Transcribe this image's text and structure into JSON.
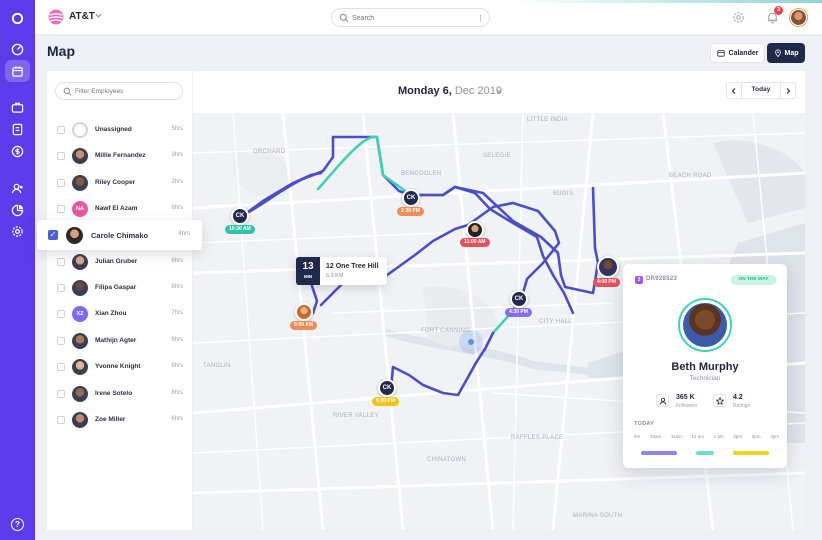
{
  "topbar": {
    "brand": "AT&T",
    "search_placeholder": "Search",
    "notifications_count": "3"
  },
  "page": {
    "title": "Map",
    "calendar_label": "Calander",
    "map_label": "Map"
  },
  "panel": {
    "filter_placeholder": "Filter Employees",
    "employees": [
      {
        "name": "Unassigned",
        "hours": "5hrs",
        "avatar": "ring"
      },
      {
        "name": "Millie Fernandez",
        "hours": "3hrs",
        "avatar": "photo"
      },
      {
        "name": "Riley Cooper",
        "hours": "2hrs",
        "avatar": "photo"
      },
      {
        "name": "Nawf El Azam",
        "hours": "6hrs",
        "avatar": "NA",
        "color": "#e85a9e"
      },
      {
        "name": "Carole Chimako",
        "hours": "4hrs",
        "avatar": "photo",
        "selected": true
      },
      {
        "name": "Julian Gruber",
        "hours": "6hrs",
        "avatar": "photo"
      },
      {
        "name": "Filipa Gaspar",
        "hours": "8hrs",
        "avatar": "photo"
      },
      {
        "name": "Xian Zhou",
        "hours": "7hrs",
        "avatar": "XZ",
        "color": "#7a6cf0"
      },
      {
        "name": "Mathijn Agter",
        "hours": "6hrs",
        "avatar": "photo"
      },
      {
        "name": "Yvonne Knight",
        "hours": "8hrs",
        "avatar": "photo"
      },
      {
        "name": "Irene Sotelo",
        "hours": "8hrs",
        "avatar": "photo"
      },
      {
        "name": "Zoe Miller",
        "hours": "6hrs",
        "avatar": "photo"
      }
    ]
  },
  "date": {
    "day": "Monday 6,",
    "month_year": "Dec 2019",
    "today_label": "Today"
  },
  "map": {
    "labels": [
      "LITTLE INDIA",
      "ORCHARD",
      "BENCOOLEN",
      "SELEGIE",
      "BUGIS",
      "BEACH ROAD",
      "CITY HALL",
      "FORT CANNING",
      "CHINATOWN",
      "RAFFLES PLACE",
      "MARINA SOUTH",
      "TANGLIN",
      "RIVER VALLEY"
    ],
    "stops": [
      {
        "label": "CK",
        "time": "10:30 AM",
        "color": "#2fc3a6"
      },
      {
        "label": "CK",
        "time": "2:30 PM",
        "color": "#ef8b54"
      },
      {
        "label": "CK",
        "time": "4:30 PM",
        "color": "#8a6cf0"
      },
      {
        "label": "CK",
        "time": "6:00 PM",
        "color": "#f2c318"
      },
      {
        "label": "photo",
        "time": "11:00 AM",
        "color": "#e5515b"
      },
      {
        "label": "photo",
        "time": "9:00 AM",
        "color": "#ef8b54"
      },
      {
        "label": "photo",
        "time": "4:00 PM",
        "color": "#e5515b"
      }
    ],
    "tooltip": {
      "num": "13",
      "unit": "MIN",
      "address": "12 One Tree Hill",
      "distance": "6.3 KM"
    }
  },
  "card": {
    "rank": "3",
    "id": "DR928523",
    "status": "ON THE WAY",
    "name": "Beth Murphy",
    "role": "Technician",
    "followers_value": "365 K",
    "followers_label": "Followers",
    "ratings_value": "4.2",
    "ratings_label": "Ratings",
    "today_label": "TODAY",
    "hours": [
      "9m",
      "10am",
      "11am",
      "12 am",
      "1 am",
      "2pm",
      "3pm",
      "4pm"
    ],
    "timeline": [
      {
        "color": "#8e86f0"
      },
      {
        "color": "#6fdcc4"
      },
      {
        "color": "#f2d218"
      }
    ]
  },
  "colors": {
    "rail": "#5b3bea",
    "accent_dark": "#1f2a4a",
    "route_blue": "#4b4fc6",
    "route_teal": "#3fd1b8"
  }
}
